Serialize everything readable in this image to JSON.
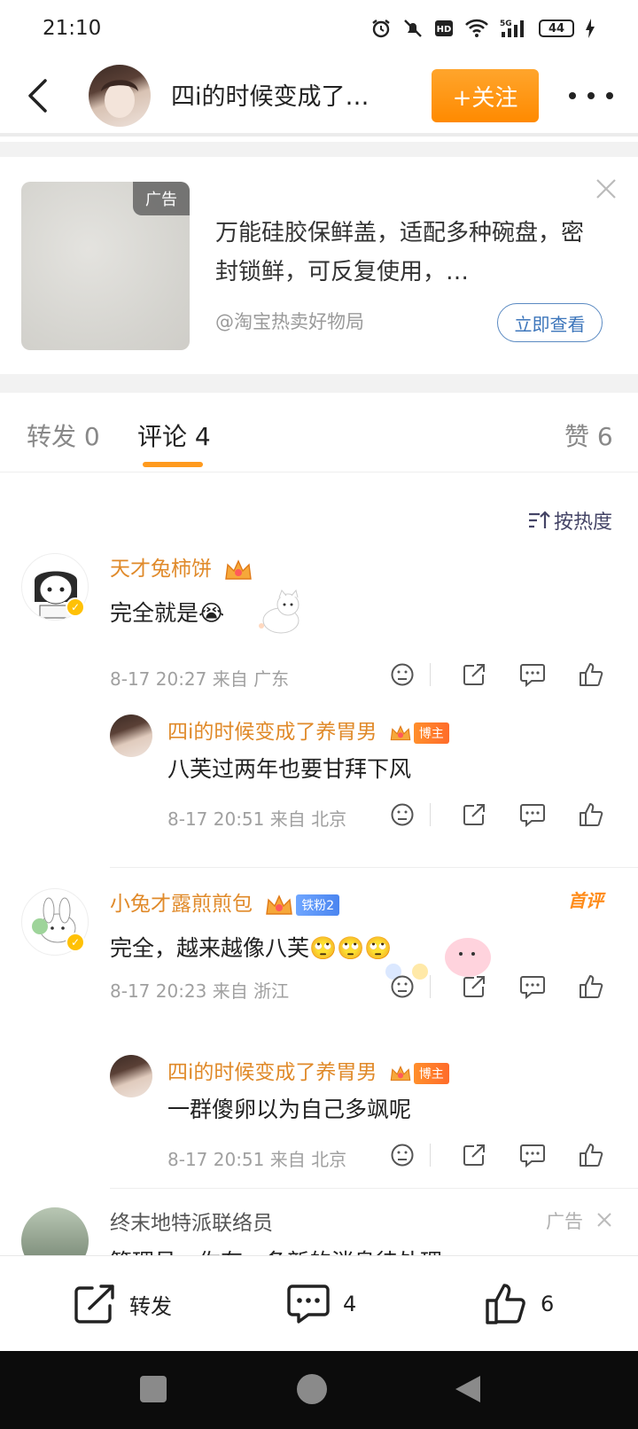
{
  "status_bar": {
    "time": "21:10",
    "battery": "44"
  },
  "header": {
    "title": "四i的时候变成了…",
    "follow_label": "+关注"
  },
  "ad": {
    "badge": "广告",
    "text": "万能硅胶保鲜盖，适配多种碗盘，密封锁鲜，可反复使用，…",
    "source": "@淘宝热卖好物局",
    "cta": "立即查看"
  },
  "tabs": [
    {
      "label": "转发 0"
    },
    {
      "label": "评论 4"
    },
    {
      "label": "赞 6"
    }
  ],
  "sort_label": "按热度",
  "comments": [
    {
      "name": "天才兔柿饼",
      "text": "完全就是😭",
      "meta": "8-17 20:27  来自 广东",
      "reply": {
        "name": "四i的时候变成了养胃男",
        "tag": "博主",
        "text": "八芙过两年也要甘拜下风",
        "meta": "8-17 20:51  来自 北京"
      }
    },
    {
      "name": "小兔才露煎煎包",
      "fan_tag": "铁粉2",
      "first_tag": "首评",
      "text": "完全，越来越像八芙🙄🙄🙄",
      "meta": "8-17 20:23  来自 浙江",
      "reply": {
        "name": "四i的时候变成了养胃男",
        "tag": "博主",
        "text": "一群傻卵以为自己多飒呢",
        "meta": "8-17 20:51  来自 北京"
      }
    }
  ],
  "ad_comment": {
    "name": "终末地特派联络员",
    "tag": "广告",
    "text": "管理员，你有一条新的消息待处理"
  },
  "bottom_bar": {
    "repost_label": "转发",
    "comment_count": "4",
    "like_count": "6"
  },
  "colors": {
    "accent": "#ff9a1e",
    "name": "#e08a2a",
    "link": "#3d76bb"
  }
}
